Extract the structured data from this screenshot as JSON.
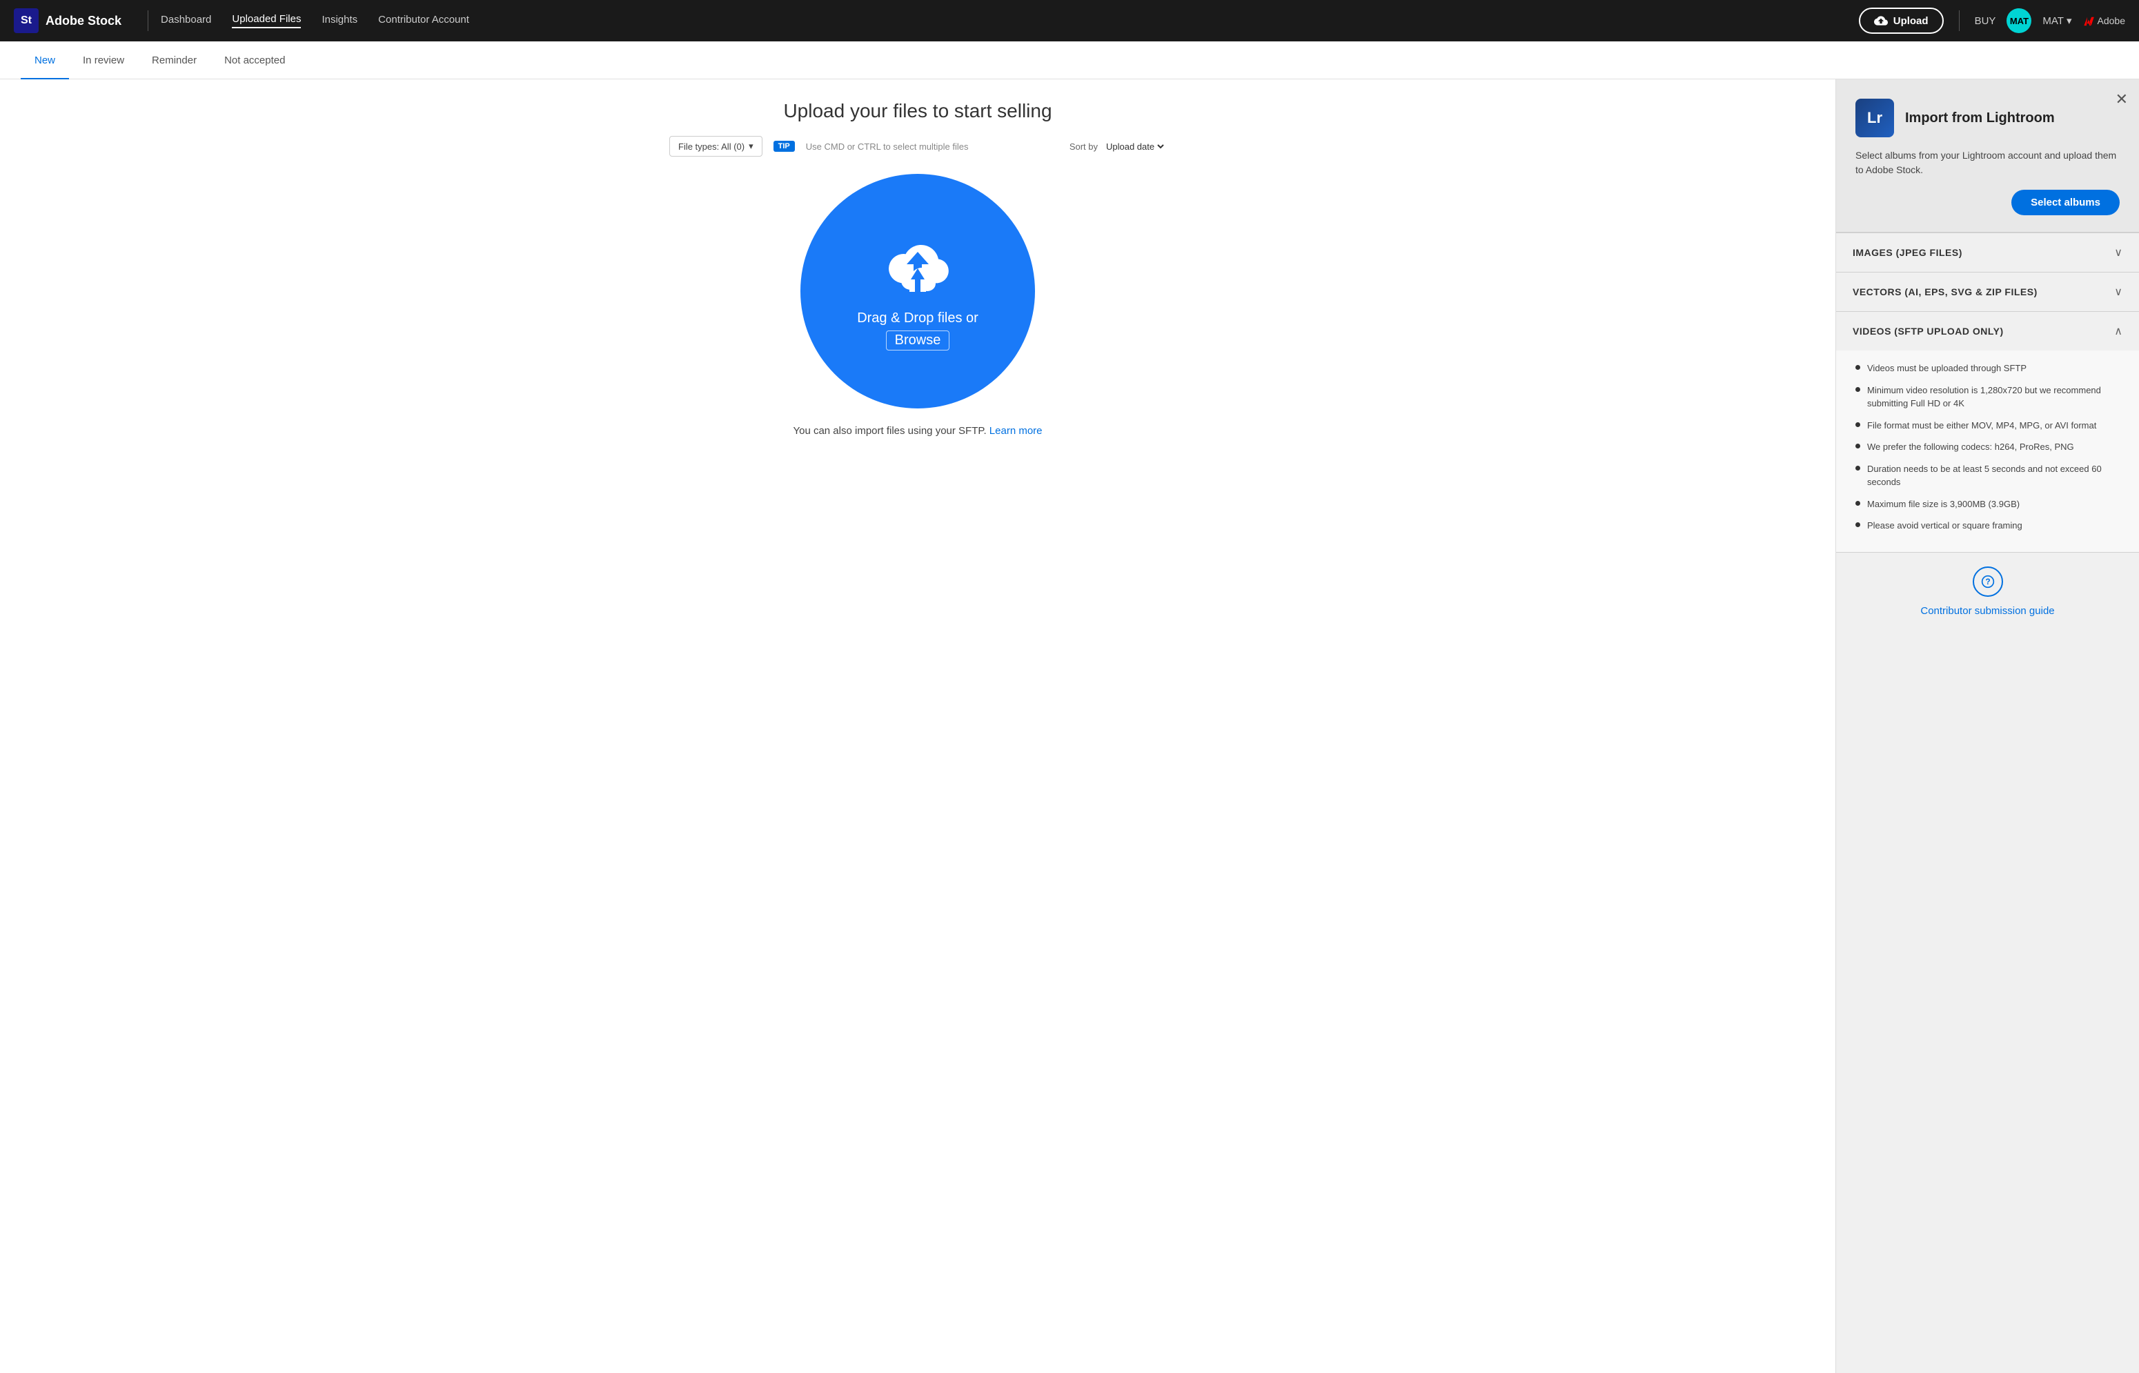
{
  "nav": {
    "logo_initials": "St",
    "logo_text": "Adobe Stock",
    "links": [
      {
        "label": "Dashboard",
        "active": false
      },
      {
        "label": "Uploaded Files",
        "active": true
      },
      {
        "label": "Insights",
        "active": false
      },
      {
        "label": "Contributor Account",
        "active": false
      }
    ],
    "upload_label": "Upload",
    "buy_label": "BUY",
    "user_label": "MAT",
    "adobe_label": "Adobe"
  },
  "tabs": [
    {
      "label": "New",
      "active": true
    },
    {
      "label": "In review",
      "active": false
    },
    {
      "label": "Reminder",
      "active": false
    },
    {
      "label": "Not accepted",
      "active": false
    }
  ],
  "filter": {
    "file_types_label": "File types: All (0)",
    "tip_label": "TIP",
    "tip_text": "Use CMD or CTRL to select multiple files",
    "sort_label": "Sort by",
    "sort_value": "Upload date"
  },
  "upload": {
    "title": "Upload your files to start selling",
    "drag_drop_text": "Drag & Drop files or",
    "browse_label": "Browse",
    "sftp_text": "You can also import files using your SFTP.",
    "learn_more_label": "Learn more"
  },
  "lightroom": {
    "icon_label": "Lr",
    "title": "Import from Lightroom",
    "description": "Select albums from your Lightroom account and upload them to Adobe Stock.",
    "button_label": "Select albums"
  },
  "accordion": [
    {
      "id": "images",
      "title": "IMAGES (JPEG FILES)",
      "expanded": false,
      "items": []
    },
    {
      "id": "vectors",
      "title": "VECTORS (AI, EPS, SVG & ZIP FILES)",
      "expanded": false,
      "items": []
    },
    {
      "id": "videos",
      "title": "VIDEOS (SFTP UPLOAD ONLY)",
      "expanded": true,
      "items": [
        "Videos must be uploaded through SFTP",
        "Minimum video resolution is 1,280x720 but we recommend submitting Full HD or 4K",
        "File format must be either MOV, MP4, MPG, or AVI format",
        "We prefer the following codecs: h264, ProRes, PNG",
        "Duration needs to be at least 5 seconds and not exceed 60 seconds",
        "Maximum file size is 3,900MB (3.9GB)",
        "Please avoid vertical or square framing"
      ]
    }
  ],
  "contributor_link_label": "Contributor submission guide",
  "colors": {
    "blue": "#0070e0",
    "dark_bg": "#1a1a1a",
    "upload_circle": "#1a7af8"
  }
}
